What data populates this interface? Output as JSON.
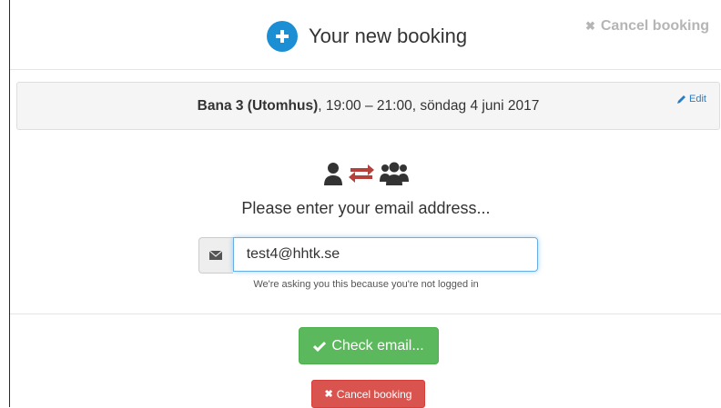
{
  "header": {
    "title": "Your new booking",
    "cancel_label": "Cancel booking",
    "icon": "plus-circle-icon",
    "accent_color": "#1c8fd4"
  },
  "summary": {
    "court": "Bana 3 (Utomhus)",
    "details": ", 19:00 – 21:00, söndag 4 juni 2017",
    "edit_label": "Edit"
  },
  "main": {
    "icons": [
      "user-icon",
      "exchange-icon",
      "users-icon"
    ],
    "prompt": "Please enter your email address...",
    "email_value": "test4@hhtk.se",
    "email_icon": "envelope-icon",
    "hint": "We're asking you this because you're not logged in"
  },
  "actions": {
    "check_label": "Check email...",
    "check_color": "#5cb85c",
    "cancel_label": "Cancel booking",
    "cancel_color": "#d9534f"
  }
}
